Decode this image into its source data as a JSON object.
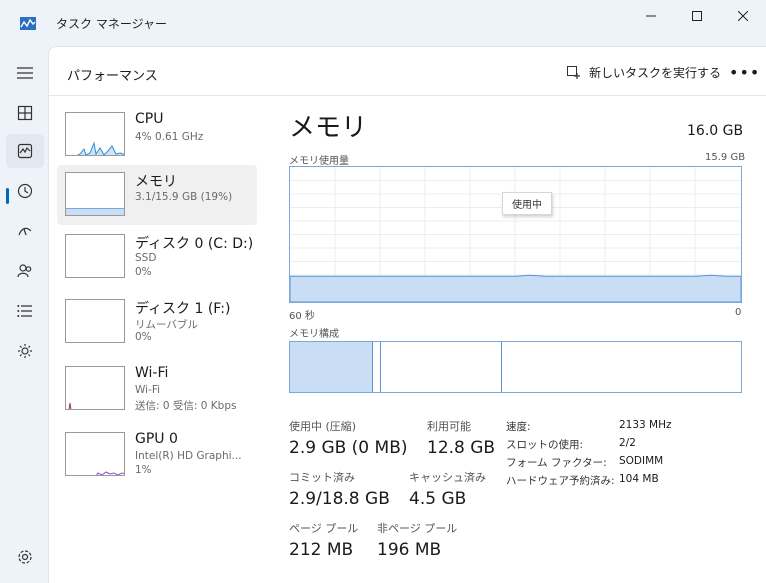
{
  "window": {
    "title": "タスク マネージャー",
    "minimize_icon": "minimize-icon",
    "maximize_icon": "maximize-icon",
    "close_icon": "close-icon"
  },
  "nav": {
    "items": [
      {
        "icon": "hamburger-menu-icon"
      },
      {
        "icon": "processes-icon"
      },
      {
        "icon": "performance-icon",
        "active": true
      },
      {
        "icon": "app-history-icon"
      },
      {
        "icon": "startup-apps-icon"
      },
      {
        "icon": "users-icon"
      },
      {
        "icon": "details-icon"
      },
      {
        "icon": "services-icon"
      },
      {
        "icon": "settings-icon"
      }
    ]
  },
  "header": {
    "title": "パフォーマンス",
    "run_task_label": "新しいタスクを実行する",
    "more_label": "•••"
  },
  "resources": [
    {
      "name": "CPU",
      "sub1": "4%  0.61 GHz",
      "sub2": "",
      "sub3": ""
    },
    {
      "name": "メモリ",
      "sub1": "3.1/15.9 GB (19%)",
      "sub2": "",
      "sub3": ""
    },
    {
      "name": "ディスク 0 (C: D:)",
      "sub1": "SSD",
      "sub2": "0%",
      "sub3": ""
    },
    {
      "name": "ディスク 1 (F:)",
      "sub1": "リムーバブル",
      "sub2": "0%",
      "sub3": ""
    },
    {
      "name": "Wi-Fi",
      "sub1": "Wi-Fi",
      "sub2": "送信: 0 受信: 0 Kbps",
      "sub3": ""
    },
    {
      "name": "GPU 0",
      "sub1": "Intel(R) HD Graphi...",
      "sub2": "1%",
      "sub3": ""
    }
  ],
  "detail": {
    "title": "メモリ",
    "total": "16.0 GB",
    "usage_label": "メモリ使用量",
    "usage_max": "15.9 GB",
    "time_left": "60 秒",
    "time_right": "0",
    "tooltip": "使用中",
    "usage_fraction": 0.19,
    "composition_label": "メモリ構成",
    "colors": {
      "accent": "#0078d4",
      "fill": "#c9ddf5",
      "line": "#7da7d9"
    }
  },
  "stats": {
    "in_use_label": "使用中 (圧縮)",
    "in_use_value": "2.9 GB (0 MB)",
    "available_label": "利用可能",
    "available_value": "12.8 GB",
    "committed_label": "コミット済み",
    "committed_value": "2.9/18.8 GB",
    "cached_label": "キャッシュ済み",
    "cached_value": "4.5 GB",
    "paged_label": "ページ プール",
    "paged_value": "212 MB",
    "nonpaged_label": "非ページ プール",
    "nonpaged_value": "196 MB"
  },
  "specs": [
    {
      "label": "速度:",
      "value": "2133 MHz"
    },
    {
      "label": "スロットの使用:",
      "value": "2/2"
    },
    {
      "label": "フォーム ファクター:",
      "value": "SODIMM"
    },
    {
      "label": "ハードウェア予約済み:",
      "value": "104 MB"
    }
  ]
}
